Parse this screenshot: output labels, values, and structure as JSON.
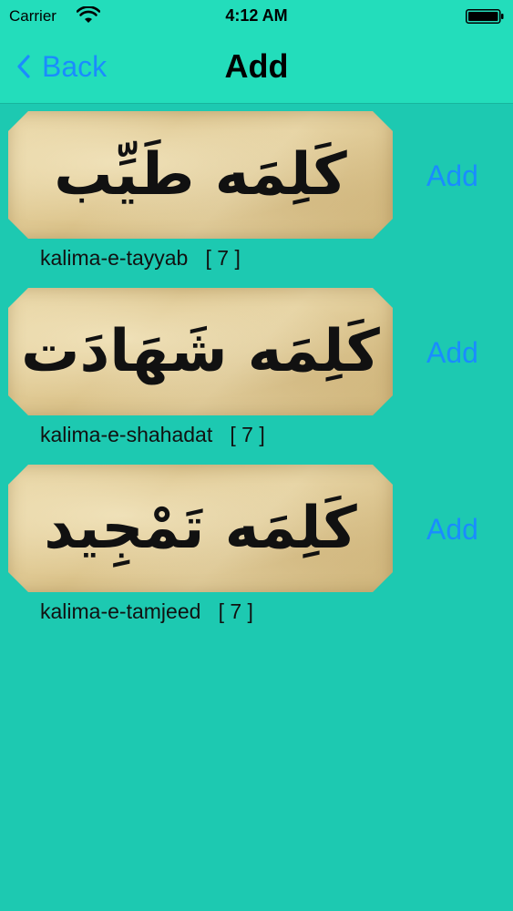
{
  "status_bar": {
    "carrier": "Carrier",
    "time": "4:12 AM"
  },
  "nav": {
    "back_label": "Back",
    "title": "Add"
  },
  "items": [
    {
      "arabic": "كَلِمَه طَيِّب",
      "caption": "kalima-e-tayyab",
      "count": "[ 7 ]",
      "add_label": "Add"
    },
    {
      "arabic": "كَلِمَه شَهَادَت",
      "caption": "kalima-e-shahadat",
      "count": "[ 7 ]",
      "add_label": "Add"
    },
    {
      "arabic": "كَلِمَه تَمْجِيد",
      "caption": "kalima-e-tamjeed",
      "count": "[ 7 ]",
      "add_label": "Add"
    }
  ],
  "colors": {
    "background": "#1dc9b1",
    "bar": "#23ddbb",
    "accent": "#1a8cff"
  }
}
